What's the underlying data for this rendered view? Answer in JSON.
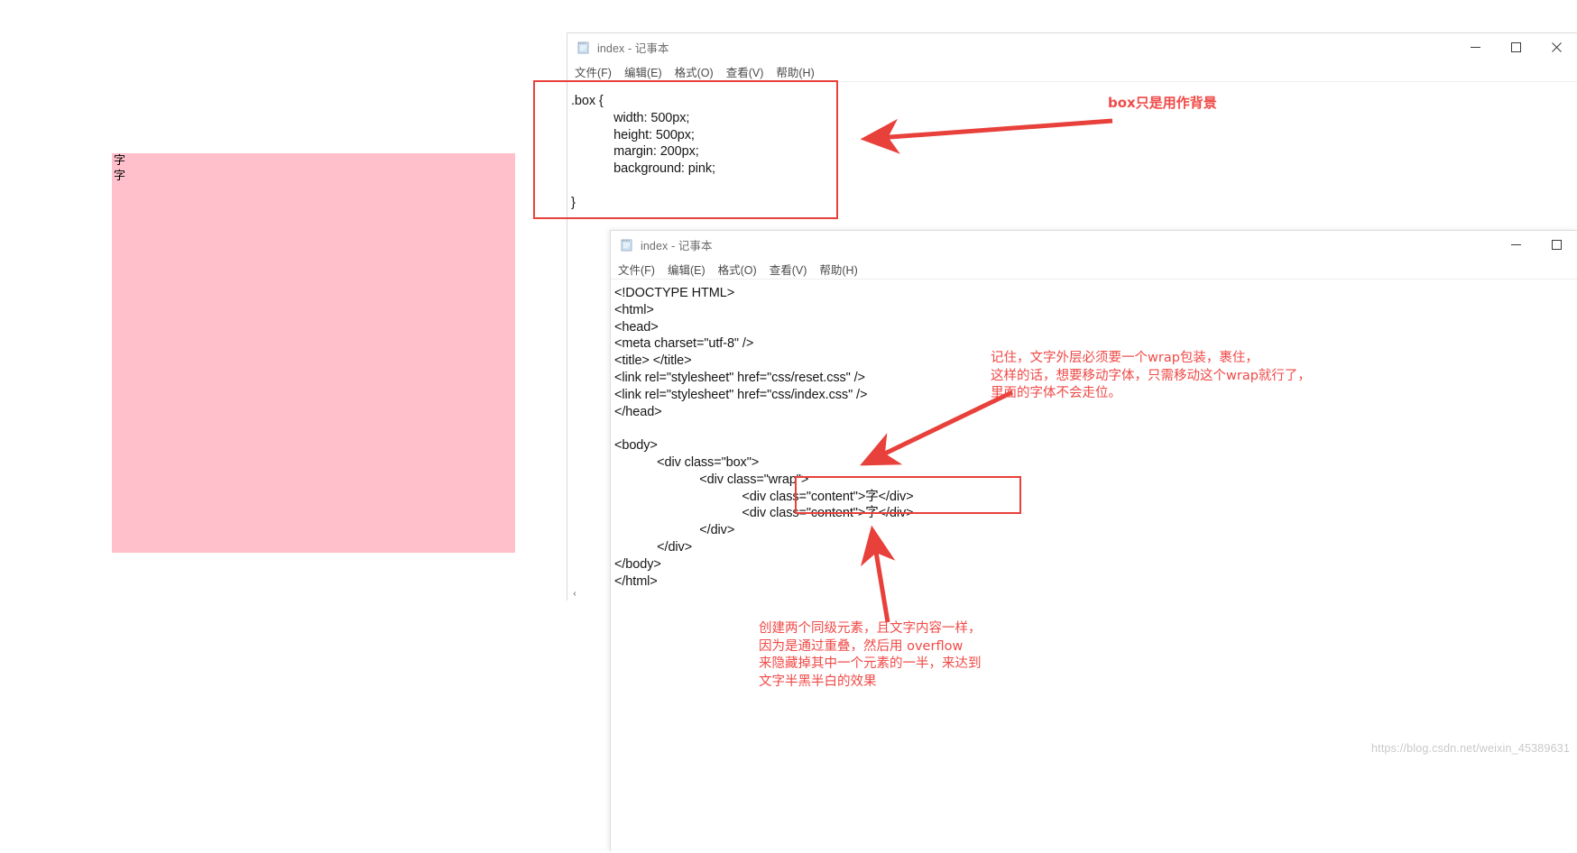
{
  "pink_preview": {
    "lines": [
      "字",
      "字"
    ],
    "background_color": "#FFC0CB"
  },
  "notepad_css": {
    "title": "index - 记事本",
    "icon": "notepad-icon",
    "menu": [
      "文件(F)",
      "编辑(E)",
      "格式(O)",
      "查看(V)",
      "帮助(H)"
    ],
    "window_buttons": {
      "minimize": "minimize-icon",
      "maximize": "maximize-icon",
      "close": "close-icon"
    },
    "code_lines": [
      ".box {",
      "            width: 500px;",
      "            height: 500px;",
      "            margin: 200px;",
      "            background: pink;",
      "",
      "}"
    ],
    "scroll_left_arrow": "‹"
  },
  "notepad_html": {
    "title": "index - 记事本",
    "icon": "notepad-icon",
    "menu": [
      "文件(F)",
      "编辑(E)",
      "格式(O)",
      "查看(V)",
      "帮助(H)"
    ],
    "window_buttons": {
      "minimize": "minimize-icon",
      "maximize": "maximize-icon"
    },
    "code_lines": [
      "<!DOCTYPE HTML>",
      "<html>",
      "<head>",
      "<meta charset=\"utf-8\" />",
      "<title> </title>",
      "<link rel=\"stylesheet\" href=\"css/reset.css\" />",
      "<link rel=\"stylesheet\" href=\"css/index.css\" />",
      "</head>",
      "",
      "<body>",
      "            <div class=\"box\">",
      "                        <div class=\"wrap\">",
      "                                    <div class=\"content\">字</div>",
      "                                    <div class=\"content\">字</div>",
      "                        </div>",
      "            </div>",
      "</body>",
      "</html>"
    ]
  },
  "annotations": {
    "box_background": "box只是用作背景",
    "wrap_note": "记住，文字外层必须要一个wrap包装，裹住，\n这样的话，想要移动字体，只需移动这个wrap就行了，\n里面的字体不会走位。",
    "overflow_note": "创建两个同级元素，且文字内容一样，\n因为是通过重叠，然后用 overflow\n来隐藏掉其中一个元素的一半，来达到\n文字半黑半白的效果",
    "color": "#ef4a47"
  },
  "watermark": {
    "text": "https://blog.csdn.net/weixin_45389631"
  }
}
